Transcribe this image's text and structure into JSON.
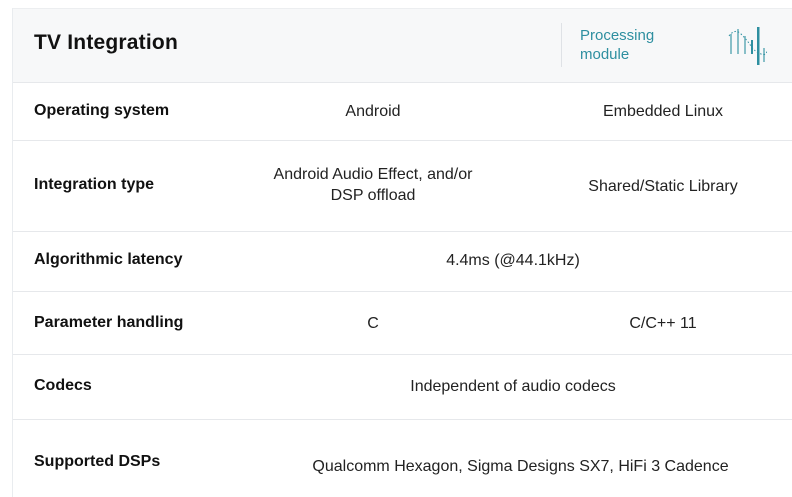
{
  "header": {
    "title": "TV Integration",
    "module_label": "Processing module",
    "icon": "waveform-icon"
  },
  "columns": [
    "Android",
    "Embedded Linux"
  ],
  "rows": [
    {
      "label": "Operating system",
      "values": [
        "Android",
        "Embedded Linux"
      ]
    },
    {
      "label": "Integration type",
      "values": [
        "Android Audio Effect, and/or DSP offload",
        "Shared/Static Library"
      ]
    },
    {
      "label": "Algorithmic latency",
      "values": [
        "4.4ms (@44.1kHz)"
      ]
    },
    {
      "label": "Parameter handling",
      "values": [
        "C",
        "C/C++ 11"
      ]
    },
    {
      "label": "Codecs",
      "values": [
        "Independent of audio codecs"
      ]
    },
    {
      "label": "Supported DSPs",
      "values": [
        "Qualcomm Hexagon, Sigma Designs SX7, HiFi 3 Cadence"
      ]
    }
  ],
  "colors": {
    "accent": "#2e8fa0",
    "header_bg": "#f7f8f9",
    "divider": "#e6e8eb"
  }
}
